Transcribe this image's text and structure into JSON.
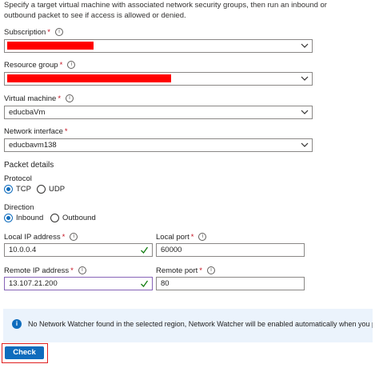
{
  "intro": {
    "line1": "Specify a target virtual machine with associated network security groups, then run an inbound or",
    "line2": "outbound packet to see if access is allowed or denied."
  },
  "subscription": {
    "label": "Subscription",
    "required": "*",
    "value": ""
  },
  "resource_group": {
    "label": "Resource group",
    "required": "*",
    "value": ""
  },
  "virtual_machine": {
    "label": "Virtual machine",
    "required": "*",
    "value": "educbaVm"
  },
  "network_interface": {
    "label": "Network interface",
    "required": "*",
    "value": "educbavm138"
  },
  "packet_details": {
    "heading": "Packet details",
    "protocol": {
      "label": "Protocol",
      "options": [
        "TCP",
        "UDP"
      ],
      "selected": "TCP"
    },
    "direction": {
      "label": "Direction",
      "options": [
        "Inbound",
        "Outbound"
      ],
      "selected": "Inbound"
    }
  },
  "local_ip": {
    "label": "Local IP address",
    "required": "*",
    "value": "10.0.0.4"
  },
  "local_port": {
    "label": "Local port",
    "required": "*",
    "value": "60000"
  },
  "remote_ip": {
    "label": "Remote IP address",
    "required": "*",
    "value": "13.107.21.200"
  },
  "remote_port": {
    "label": "Remote port",
    "required": "*",
    "value": "80"
  },
  "banner": {
    "icon": "info-icon",
    "text": "No Network Watcher found in the selected region, Network Watcher will be enabled automatically when you perform t"
  },
  "check_button": {
    "label": "Check"
  },
  "colors": {
    "accent": "#0f6cbd",
    "required": "#c50f1f",
    "valid_check": "#107c10",
    "redaction": "#ff0000",
    "banner_bg": "#ebf3fc",
    "focus_border": "#8764b8"
  }
}
